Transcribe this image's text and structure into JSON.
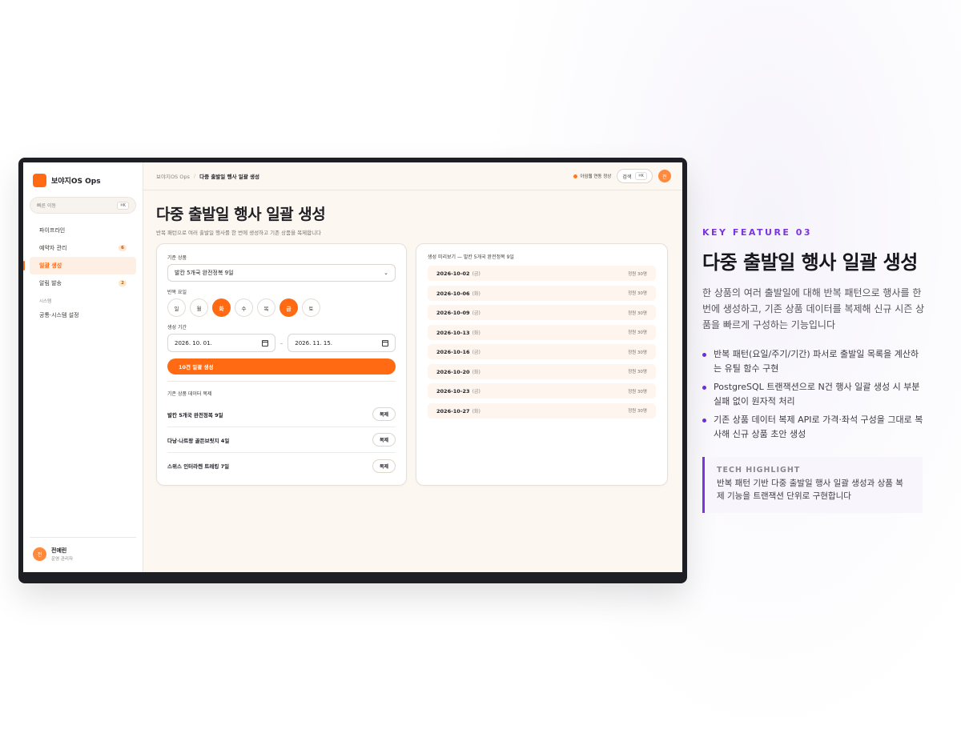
{
  "app": {
    "brand": "보야지OS Ops",
    "quick_nav": {
      "label": "빠른 이동",
      "shortcut": "⌘K"
    },
    "nav": [
      {
        "label": "파이프라인",
        "badge": ""
      },
      {
        "label": "예약자 관리",
        "badge": "6"
      },
      {
        "label": "일괄 생성",
        "badge": "",
        "active": true
      },
      {
        "label": "알림 발송",
        "badge": "2"
      }
    ],
    "nav_section": "시스템",
    "nav_system": [
      {
        "label": "공통·시스템 설정"
      }
    ],
    "user": {
      "initial": "전",
      "name": "전예린",
      "role": "운영 관리자"
    },
    "topbar": {
      "crumb_root": "보야지OS Ops",
      "crumb_current": "다중 출발일 행사 일괄 생성",
      "status": "아임웹 연동 정상",
      "search_label": "검색",
      "search_shortcut": "⌘K",
      "avatar_initial": "전"
    },
    "page": {
      "title": "다중 출발일 행사 일괄 생성",
      "subtitle": "반복 패턴으로 여러 출발일 행사를 한 번에 생성하고 기존 상품을 복제합니다"
    },
    "form": {
      "base_label": "기준 상품",
      "base_value": "발칸 5개국 완전정복 9일",
      "repeat_label": "반복 요일",
      "days": [
        {
          "label": "일",
          "selected": false
        },
        {
          "label": "월",
          "selected": false
        },
        {
          "label": "화",
          "selected": true
        },
        {
          "label": "수",
          "selected": false
        },
        {
          "label": "목",
          "selected": false
        },
        {
          "label": "금",
          "selected": true
        },
        {
          "label": "토",
          "selected": false
        }
      ],
      "period_label": "생성 기간",
      "start_date": "2026. 10. 01.",
      "date_sep": "–",
      "end_date": "2026. 11. 15.",
      "generate_label": "10건 일괄 생성",
      "copy_title": "기존 상품 데이터 복제",
      "copy_items": [
        {
          "name": "발칸 5개국 완전정복 9일",
          "action": "복제"
        },
        {
          "name": "다낭·나트랑 골든브릿지 4일",
          "action": "복제"
        },
        {
          "name": "스위스 인터라켄 트레킹 7일",
          "action": "복제"
        }
      ]
    },
    "preview": {
      "title": "생성 미리보기 — 발칸 5개국 완전정복 9일",
      "rows": [
        {
          "date": "2026-10-02",
          "dow": "(금)",
          "capacity": "정원 30명"
        },
        {
          "date": "2026-10-06",
          "dow": "(화)",
          "capacity": "정원 30명"
        },
        {
          "date": "2026-10-09",
          "dow": "(금)",
          "capacity": "정원 30명"
        },
        {
          "date": "2026-10-13",
          "dow": "(화)",
          "capacity": "정원 30명"
        },
        {
          "date": "2026-10-16",
          "dow": "(금)",
          "capacity": "정원 30명"
        },
        {
          "date": "2026-10-20",
          "dow": "(화)",
          "capacity": "정원 30명"
        },
        {
          "date": "2026-10-23",
          "dow": "(금)",
          "capacity": "정원 30명"
        },
        {
          "date": "2026-10-27",
          "dow": "(화)",
          "capacity": "정원 30명"
        }
      ]
    }
  },
  "feature": {
    "label": "KEY FEATURE 03",
    "title": "다중 출발일 행사 일괄 생성",
    "description": "한 상품의 여러 출발일에 대해 반복 패턴으로 행사를 한 번에 생성하고, 기존 상품 데이터를 복제해 신규 시즌 상품을 빠르게 구성하는 기능입니다",
    "bullets": [
      "반복 패턴(요일/주기/기간) 파서로 출발일 목록을 계산하는 유틸 함수 구현",
      "PostgreSQL 트랜잭션으로 N건 행사 일괄 생성 시 부분 실패 없이 원자적 처리",
      "기존 상품 데이터 복제 API로 가격·좌석 구성을 그대로 복사해 신규 상품 초안 생성"
    ],
    "tech_label": "TECH HIGHLIGHT",
    "tech_text": "반복 패턴 기반 다중 출발일 행사 일괄 생성과 상품 복제 기능을 트랜잭션 단위로 구현합니다"
  },
  "colors": {
    "accent": "#ff6a13",
    "feature_accent": "#7a34e0"
  }
}
